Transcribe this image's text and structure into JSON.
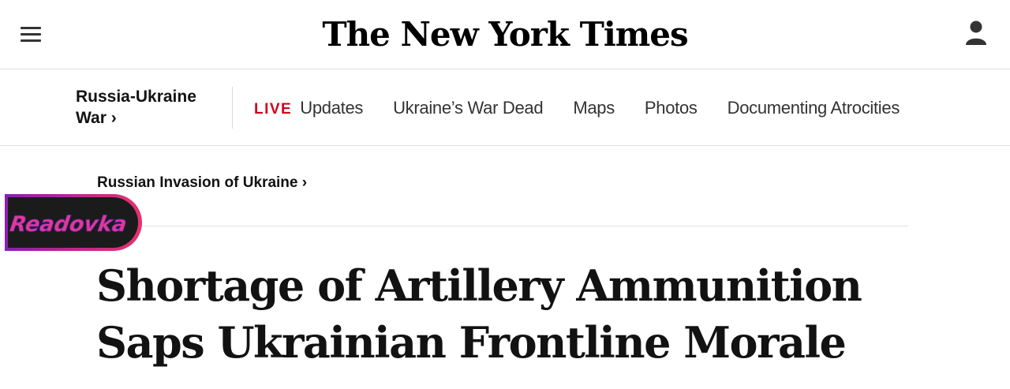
{
  "masthead": {
    "logo_text": "The New York Times",
    "menu_icon": "hamburger-menu-icon",
    "account_icon": "user-account-icon"
  },
  "section_nav": {
    "section_title": "Russia-Ukraine War ›",
    "live_label": "LIVE",
    "links": [
      "Updates",
      "Ukraine’s War Dead",
      "Maps",
      "Photos",
      "Documenting Atrocities"
    ],
    "live_color": "#d0021b"
  },
  "article": {
    "kicker": "Russian Invasion of Ukraine ›",
    "headline": "Shortage of Artillery Ammunition Saps Ukrainian Frontline Morale"
  },
  "watermark": {
    "text": "Readovka",
    "colors": [
      "#7a1fa2",
      "#e8316f",
      "#1b1b1b"
    ]
  }
}
